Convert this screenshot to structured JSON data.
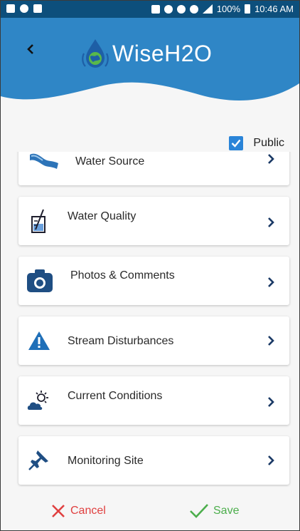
{
  "status_bar": {
    "battery": "100%",
    "time": "10:46 AM"
  },
  "app": {
    "title": "WiseH2O"
  },
  "public_toggle": {
    "label": "Public",
    "checked": true
  },
  "menu": [
    {
      "label": "Water Source",
      "icon": "water-source-icon"
    },
    {
      "label": "Water Quality",
      "icon": "beaker-icon"
    },
    {
      "label": "Photos & Comments",
      "icon": "camera-icon"
    },
    {
      "label": "Stream Disturbances",
      "icon": "warning-icon"
    },
    {
      "label": "Current Conditions",
      "icon": "weather-icon"
    },
    {
      "label": "Monitoring Site",
      "icon": "pushpin-icon"
    }
  ],
  "footer": {
    "cancel_label": "Cancel",
    "save_label": "Save"
  },
  "colors": {
    "status_bar": "#0d4f7c",
    "header_wave": "#2f86c6",
    "card_icon": "#1f4e83",
    "cancel": "#e04040",
    "save": "#4cae4c",
    "checkbox": "#2a84d8"
  }
}
